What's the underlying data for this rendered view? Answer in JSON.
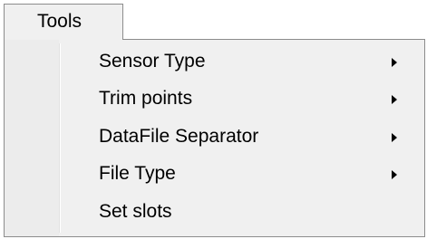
{
  "menubar": {
    "tools_label": "Tools"
  },
  "dropdown": {
    "items": [
      {
        "label": "Sensor Type",
        "has_submenu": true
      },
      {
        "label": "Trim points",
        "has_submenu": true
      },
      {
        "label": "DataFile Separator",
        "has_submenu": true
      },
      {
        "label": "File Type",
        "has_submenu": true
      },
      {
        "label": "Set slots",
        "has_submenu": false
      }
    ],
    "submenu_icon": "submenu-arrow-icon"
  },
  "colors": {
    "menu_background": "#f0f0f0",
    "border": "#8c8c8c",
    "text": "#000000"
  }
}
